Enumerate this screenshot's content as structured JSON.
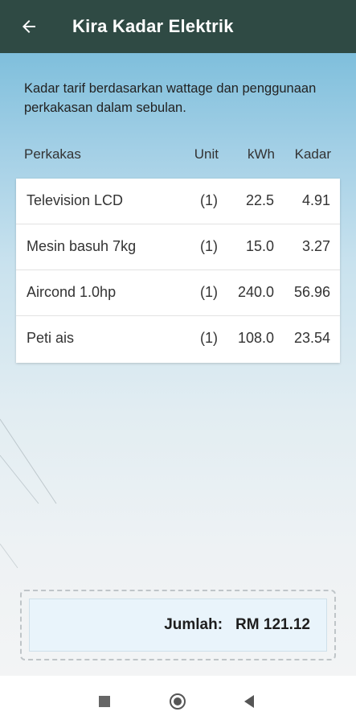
{
  "app_bar": {
    "title": "Kira Kadar Elektrik",
    "back_icon": "arrow-left-icon"
  },
  "intro": {
    "text": "Kadar tarif berdasarkan wattage dan penggunaan perkakasan dalam sebulan."
  },
  "table": {
    "headers": {
      "name": "Perkakas",
      "unit": "Unit",
      "kwh": "kWh",
      "rate": "Kadar"
    },
    "rows": [
      {
        "name": "Television LCD",
        "unit": "(1)",
        "kwh": "22.5",
        "rate": "4.91"
      },
      {
        "name": "Mesin basuh 7kg",
        "unit": "(1)",
        "kwh": "15.0",
        "rate": "3.27"
      },
      {
        "name": "Aircond 1.0hp",
        "unit": "(1)",
        "kwh": "240.0",
        "rate": "56.96"
      },
      {
        "name": "Peti ais",
        "unit": "(1)",
        "kwh": "108.0",
        "rate": "23.54"
      }
    ]
  },
  "total": {
    "label": "Jumlah:",
    "value": "RM 121.12"
  },
  "colors": {
    "app_bar": "#2f4a44",
    "total_box": "#e9f4fb"
  },
  "nav": {
    "recents_icon": "square-icon",
    "home_icon": "circle-home-icon",
    "back_icon": "triangle-back-icon"
  }
}
